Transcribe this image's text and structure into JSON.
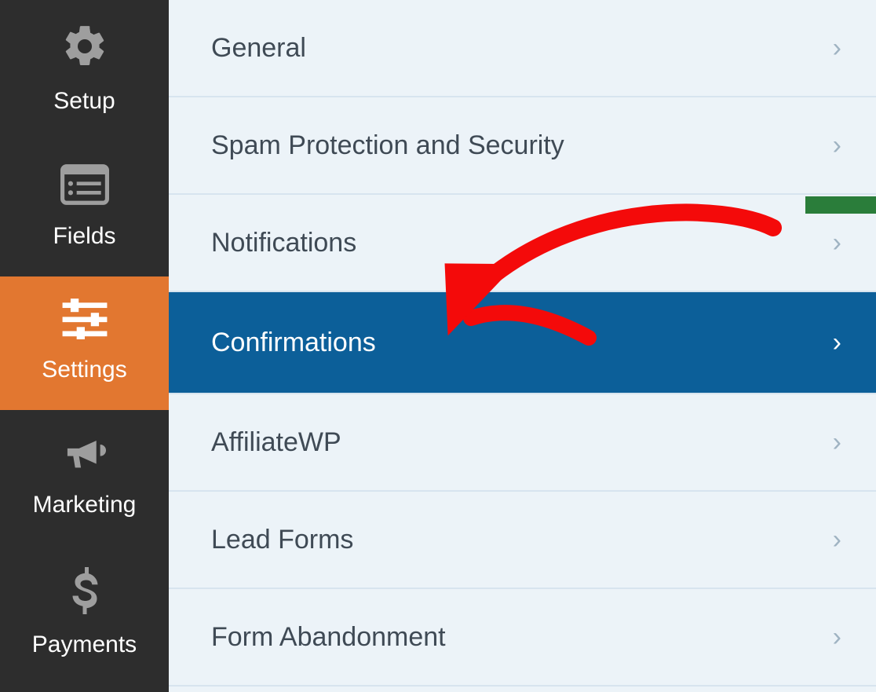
{
  "sidebar": {
    "items": [
      {
        "id": "setup",
        "label": "Setup",
        "icon": "gear-icon",
        "active": false
      },
      {
        "id": "fields",
        "label": "Fields",
        "icon": "list-icon",
        "active": false
      },
      {
        "id": "settings",
        "label": "Settings",
        "icon": "sliders-icon",
        "active": true
      },
      {
        "id": "marketing",
        "label": "Marketing",
        "icon": "bullhorn-icon",
        "active": false
      },
      {
        "id": "payments",
        "label": "Payments",
        "icon": "dollar-icon",
        "active": false
      }
    ]
  },
  "settings_panel": {
    "items": [
      {
        "id": "general",
        "label": "General",
        "selected": false
      },
      {
        "id": "spam",
        "label": "Spam Protection and Security",
        "selected": false
      },
      {
        "id": "notifications",
        "label": "Notifications",
        "selected": false
      },
      {
        "id": "confirmations",
        "label": "Confirmations",
        "selected": true
      },
      {
        "id": "affiliatewp",
        "label": "AffiliateWP",
        "selected": false
      },
      {
        "id": "leadforms",
        "label": "Lead Forms",
        "selected": false
      },
      {
        "id": "formabandonment",
        "label": "Form Abandonment",
        "selected": false
      }
    ]
  },
  "annotation": {
    "type": "red-arrow",
    "target": "confirmations"
  }
}
